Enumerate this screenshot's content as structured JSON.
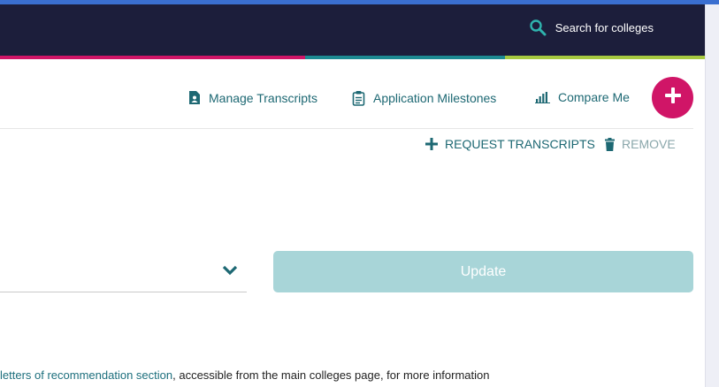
{
  "header": {
    "search_label": "Search for colleges",
    "background": "#1c1e3b",
    "strip_colors": [
      "#d01567",
      "#1d8a92",
      "#a7c940"
    ]
  },
  "subnav": {
    "links": [
      {
        "label": "Manage Transcripts",
        "icon": "document-person-icon"
      },
      {
        "label": "Application Milestones",
        "icon": "clipboard-icon"
      },
      {
        "label": "Compare Me",
        "icon": "bar-chart-icon"
      }
    ],
    "fab_icon": "plus-icon",
    "fab_color": "#d01567"
  },
  "actions": {
    "request_label": "REQUEST TRANSCRIPTS",
    "remove_label": "REMOVE"
  },
  "form": {
    "select_value": "",
    "update_label": "Update",
    "update_color": "#a8d5d8"
  },
  "info": {
    "link_text": "letters of recommendation section",
    "rest_text": ", accessible from the main colleges page, for more information"
  },
  "accent": "#1d6873"
}
